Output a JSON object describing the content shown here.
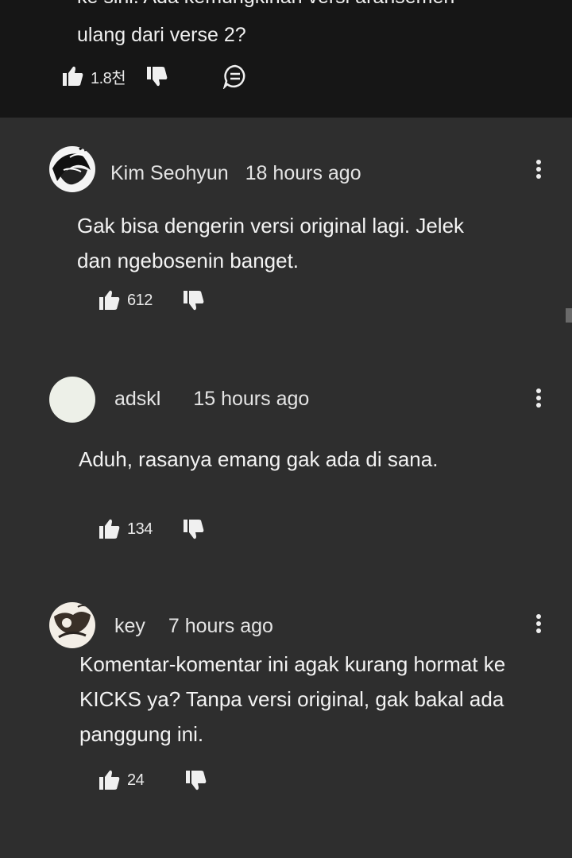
{
  "previous_comment": {
    "cut_line": "ke sini. Ada kemungkinan versi aransemen",
    "text_line": "ulang dari verse 2?",
    "like_count": "1.8천"
  },
  "comments": [
    {
      "author": "Kim Seohyun",
      "time": "18 hours ago",
      "text_lines": [
        "Gak bisa dengerin versi original lagi. Jelek",
        "dan ngebosenin banget."
      ],
      "like_count": "612"
    },
    {
      "author": "adskl",
      "time": "15 hours ago",
      "text_lines": [
        "Aduh, rasanya emang gak ada di sana."
      ],
      "like_count": "134"
    },
    {
      "author": "key",
      "time": "7 hours ago",
      "text_lines": [
        "Komentar-komentar ini agak kurang hormat ke",
        "KICKS ya? Tanpa versi original, gak bakal ada",
        "panggung ini."
      ],
      "like_count": "24"
    }
  ],
  "icons": {
    "like": "thumbs-up-icon",
    "dislike": "thumbs-down-icon",
    "reply": "reply-comment-icon",
    "more": "more-vertical-icon"
  },
  "colors": {
    "background": "#2e2e2e",
    "top_block": "#161616",
    "text": "#f1f1f1"
  }
}
